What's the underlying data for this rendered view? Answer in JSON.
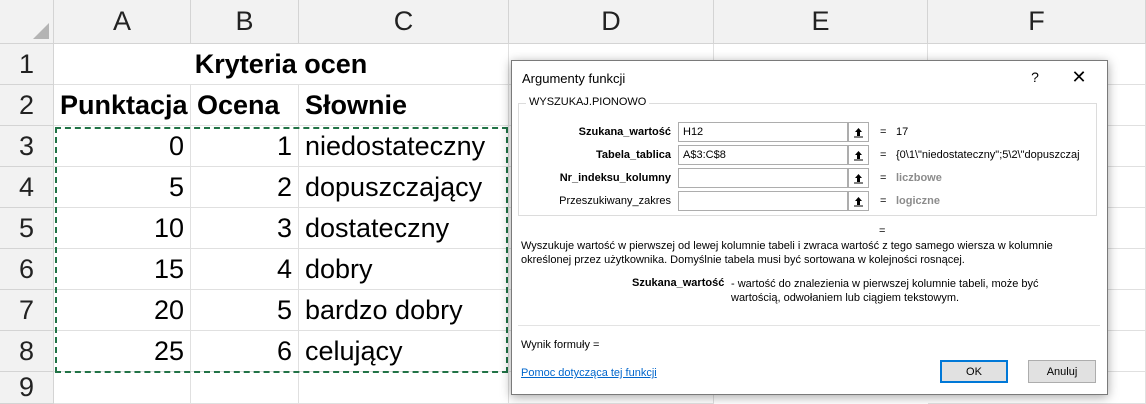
{
  "sheet": {
    "columns": [
      "A",
      "B",
      "C",
      "D",
      "E",
      "F"
    ],
    "rows": [
      "1",
      "2",
      "3",
      "4",
      "5",
      "6",
      "7",
      "8",
      "9"
    ],
    "title": "Kryteria ocen",
    "headers": {
      "a": "Punktacja",
      "b": "Ocena",
      "c": "Słownie"
    },
    "data": [
      {
        "a": "0",
        "b": "1",
        "c": "niedostateczny"
      },
      {
        "a": "5",
        "b": "2",
        "c": "dopuszczający"
      },
      {
        "a": "10",
        "b": "3",
        "c": "dostateczny"
      },
      {
        "a": "15",
        "b": "4",
        "c": "dobry"
      },
      {
        "a": "20",
        "b": "5",
        "c": "bardzo dobry"
      },
      {
        "a": "25",
        "b": "6",
        "c": "celujący"
      }
    ],
    "accent_color": "#217346"
  },
  "dialog": {
    "title": "Argumenty funkcji",
    "help_glyph": "?",
    "close_glyph": "✕",
    "function_name": "WYSZUKAJ.PIONOWO",
    "args": [
      {
        "label": "Szukana_wartość",
        "value": "H12",
        "result": "17"
      },
      {
        "label": "Tabela_tablica",
        "value": "A$3:C$8",
        "result": "{0\\1\\\"niedostateczny\";5\\2\\\"dopuszczaj"
      },
      {
        "label": "Nr_indeksu_kolumny",
        "value": "",
        "result": "liczbowe"
      },
      {
        "label": "Przeszukiwany_zakres",
        "value": "",
        "result": "logiczne"
      }
    ],
    "eq": "=",
    "description": "Wyszukuje wartość w pierwszej od lewej kolumnie tabeli i zwraca wartość z tego samego wiersza w kolumnie określonej przez użytkownika. Domyślnie tabela musi być sortowana w kolejności rosnącej.",
    "arg_desc_name": "Szukana_wartość",
    "arg_desc_text": "- wartość do znalezienia w pierwszej kolumnie tabeli, może być wartością, odwołaniem lub ciągiem tekstowym.",
    "formula_result": "Wynik formuły =",
    "help_link": "Pomoc dotycząca tej funkcji",
    "ok": "OK",
    "cancel": "Anuluj",
    "link_color": "#0066cc",
    "focus_color": "#0078d7"
  }
}
